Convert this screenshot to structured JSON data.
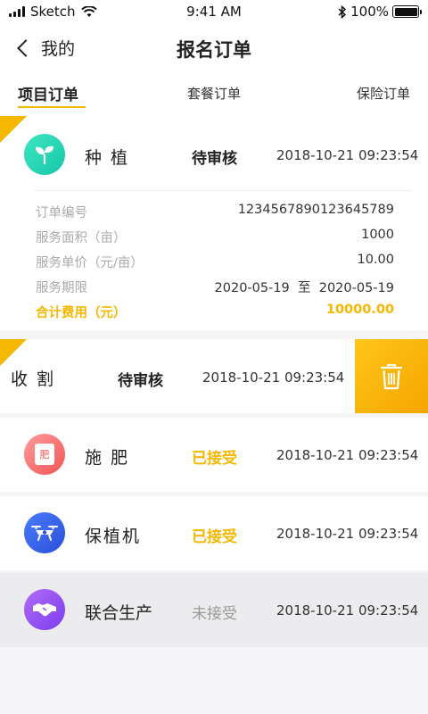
{
  "status_bar": {
    "carrier": "Sketch",
    "time": "9:41 AM",
    "battery": "100%"
  },
  "nav": {
    "back_label": "我的",
    "title": "报名订单"
  },
  "tabs": [
    {
      "label": "项目订单",
      "active": true
    },
    {
      "label": "套餐订单",
      "active": false
    },
    {
      "label": "保险订单",
      "active": false
    }
  ],
  "orders": [
    {
      "title": "种 植",
      "status": "待审核",
      "time": "2018-10-21 09:23:54",
      "icon": "sprout-icon",
      "expanded": true,
      "details": [
        {
          "label": "订单编号",
          "value": "1234567890123645789"
        },
        {
          "label": "服务面积（亩）",
          "value": "1000"
        },
        {
          "label": "服务单价（元/亩）",
          "value": "10.00"
        },
        {
          "label": "服务期限",
          "value": "2020-05-19  至  2020-05-19"
        },
        {
          "label": "合计费用（元）",
          "value": "10000.00"
        }
      ]
    },
    {
      "title": "收 割",
      "status": "待审核",
      "time": "2018-10-21 09:23:54",
      "swiped": true
    },
    {
      "title": "施 肥",
      "status": "已接受",
      "time": "2018-10-21 09:23:54",
      "icon": "fertilizer-icon",
      "icon_text": "肥"
    },
    {
      "title": "保植机",
      "status": "已接受",
      "time": "2018-10-21 09:23:54",
      "icon": "drone-icon"
    },
    {
      "title": "联合生产",
      "status": "未接受",
      "time": "2018-10-21 09:23:54",
      "icon": "handshake-icon"
    }
  ],
  "colors": {
    "accent": "#f5b800",
    "status_pending": "#222222",
    "status_accepted": "#f5b800",
    "status_not_accepted": "#999999"
  }
}
